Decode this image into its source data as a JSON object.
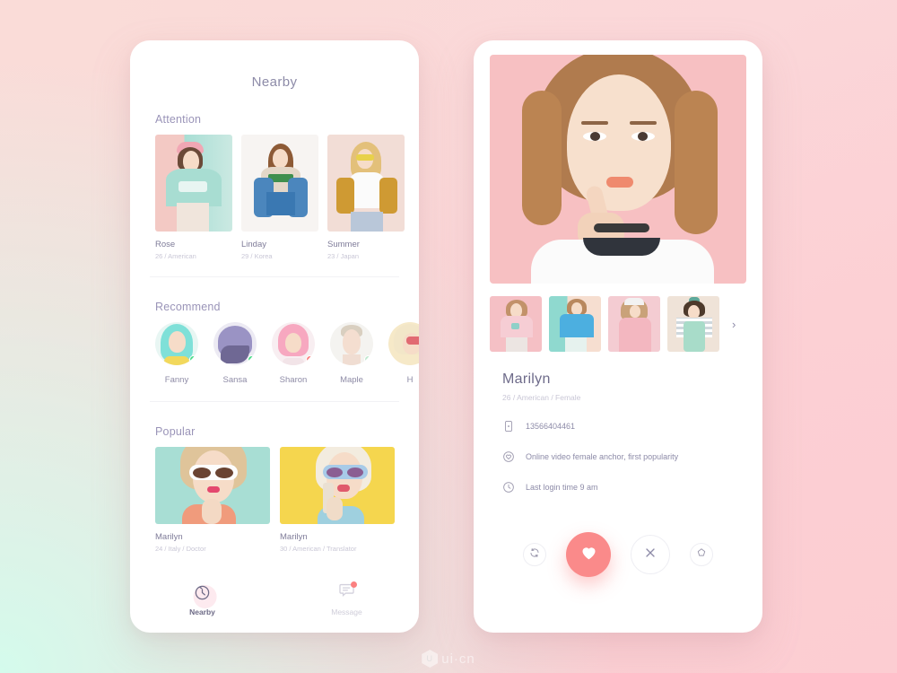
{
  "app": {
    "watermark": "ui·cn"
  },
  "left_phone": {
    "title": "Nearby",
    "sections": {
      "attention": {
        "heading": "Attention",
        "cards": [
          {
            "name": "Rose",
            "meta": "26 / American",
            "bg": "#f3c9c4",
            "accent": "#a8ded4"
          },
          {
            "name": "Linday",
            "meta": "29 / Korea",
            "bg": "#f7f4f2",
            "accent": "#5d8fc4"
          },
          {
            "name": "Summer",
            "meta": "23 / Japan",
            "bg": "#f2ddd6",
            "accent": "#d9a33c"
          }
        ]
      },
      "recommend": {
        "heading": "Recommend",
        "people": [
          {
            "name": "Fanny",
            "status_color": "#4ddc8a",
            "hair": "#7fe0d8",
            "bg": "#e8f6f3"
          },
          {
            "name": "Sansa",
            "status_color": "#4ddc8a",
            "hair": "#9a93c4",
            "bg": "#eceaf3"
          },
          {
            "name": "Sharon",
            "status_color": "#fb8080",
            "hair": "#f7a8c0",
            "bg": "#f8eef1"
          },
          {
            "name": "Maple",
            "status_color": "#bfe8cf",
            "hair": "#e7e2da",
            "bg": "#f4f3f0"
          },
          {
            "name": "H",
            "status_color": "#fb8080",
            "hair": "#f0d98a",
            "bg": "#f6e9c8"
          }
        ]
      },
      "popular": {
        "heading": "Popular",
        "cards": [
          {
            "name": "Marilyn",
            "meta": "24 / Italy / Doctor",
            "bg": "#a8ded4"
          },
          {
            "name": "Marilyn",
            "meta": "30 / American / Translator",
            "bg": "#f5d64e"
          }
        ]
      }
    },
    "tabbar": [
      {
        "label": "Nearby",
        "icon": "compass-icon",
        "active": true,
        "badge": false
      },
      {
        "label": "Message",
        "icon": "chat-icon",
        "active": false,
        "badge": true
      }
    ]
  },
  "right_phone": {
    "hero": {
      "icon": "hero-photo",
      "bg": "#f7c0c2"
    },
    "thumbnails": [
      {
        "bg": "#f5c0c5"
      },
      {
        "bg": "#8fd9cf"
      },
      {
        "bg": "#f4ccd2"
      },
      {
        "bg": "#efe3d8"
      }
    ],
    "thumb_next_icon": "chevron-right-icon",
    "profile": {
      "name": "Marilyn",
      "subtitle": "26 / American / Female",
      "details": [
        {
          "icon": "phone-icon",
          "text": "13566404461"
        },
        {
          "icon": "heart-circle-icon",
          "text": "Online video female anchor, first popularity"
        },
        {
          "icon": "clock-icon",
          "text": "Last login time 9 am"
        }
      ]
    },
    "actions": [
      {
        "name": "refresh-button",
        "icon": "refresh-icon",
        "size": "sm",
        "color": "#8d8ba8"
      },
      {
        "name": "like-button",
        "icon": "heart-icon",
        "size": "lg",
        "color": "#ffffff"
      },
      {
        "name": "dislike-button",
        "icon": "close-icon",
        "size": "md",
        "color": "#8d8ba8"
      },
      {
        "name": "bookmark-button",
        "icon": "star-icon",
        "size": "sm",
        "color": "#8d8ba8"
      }
    ]
  },
  "colors": {
    "accent": "#fa8a8a",
    "heading": "#9a94b8",
    "title": "#8d8ba8",
    "muted": "#c9c7d6"
  }
}
